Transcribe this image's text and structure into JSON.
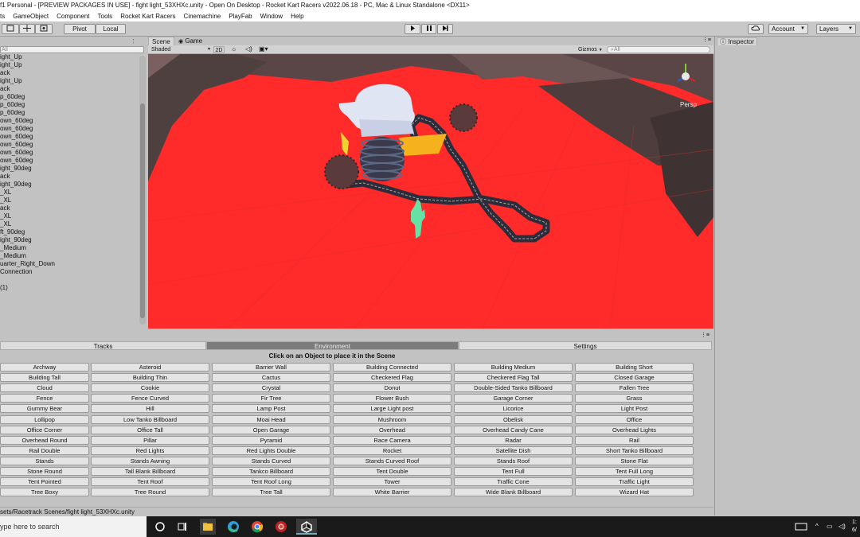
{
  "window": {
    "title": "f1 Personal - [PREVIEW PACKAGES IN USE] - fight light_53XHXc.unity - Open On Desktop - Rocket Kart Racers v2022.06.18 - PC, Mac & Linux Standalone <DX11>"
  },
  "menu": [
    "ts",
    "GameObject",
    "Component",
    "Tools",
    "Rocket Kart Racers",
    "Cinemachine",
    "PlayFab",
    "Window",
    "Help"
  ],
  "toolbar": {
    "pivot": "Pivot",
    "local": "Local",
    "account": "Account",
    "layers": "Layers"
  },
  "hierarchy": {
    "search_placeholder": "All",
    "items": [
      "ight_Up",
      "ight_Up",
      "ack",
      "ight_Up",
      "ack",
      "p_60deg",
      "p_60deg",
      "p_60deg",
      "own_60deg",
      "own_60deg",
      "own_60deg",
      "own_60deg",
      "own_60deg",
      "own_60deg",
      "ight_90deg",
      "ack",
      "ight_90deg",
      "_XL",
      "_XL",
      "ack",
      "_XL",
      "_XL",
      "ft_90deg",
      "ight_90deg",
      "_Medium",
      "_Medium",
      "uarter_Right_Down",
      "Connection",
      "",
      "(1)"
    ]
  },
  "scene": {
    "tab_scene": "Scene",
    "tab_game": "Game",
    "shading": "Shaded",
    "mode_2d": "2D",
    "gizmos": "Gizmos",
    "search_placeholder": "All",
    "persp": "Persp"
  },
  "inspector": {
    "tab": "Inspector"
  },
  "panel": {
    "tabs": [
      "Tracks",
      "Environment",
      "Settings"
    ],
    "active_tab": "Environment",
    "hint": "Click on an Object to place it in the Scene",
    "objects": [
      [
        "Archway",
        "Asteroid",
        "Barrier Wall",
        "Building Connected",
        "Building Medium",
        "Building Short"
      ],
      [
        "Building Tall",
        "Building Thin",
        "Cactus",
        "Checkered Flag",
        "Checkered Flag Tall",
        "Closed Garage"
      ],
      [
        "Cloud",
        "Cookie",
        "Crystal",
        "Donut",
        "Double-Sided Tanko Billboard",
        "Fallen Tree"
      ],
      [
        "Fence",
        "Fence Curved",
        "Fir Tree",
        "Flower Bush",
        "Garage Corner",
        "Grass"
      ],
      [
        "Gummy Bear",
        "Hill",
        "Lamp Post",
        "Large Light post",
        "Licorice",
        "Light Post"
      ],
      [
        "Lollipop",
        "Low Tanko Billboard",
        "Moai Head",
        "Mushroom",
        "Obelisk",
        "Office"
      ],
      [
        "Office Corner",
        "Office Tall",
        "Open Garage",
        "Overhead",
        "Overhead Candy Cane",
        "Overhead Lights"
      ],
      [
        "Overhead Round",
        "Pillar",
        "Pyramid",
        "Race Camera",
        "Radar",
        "Rail"
      ],
      [
        "Rail Double",
        "Red Lights",
        "Red Lights Double",
        "Rocket",
        "Satellite Dish",
        "Short Tanko Billboard"
      ],
      [
        "Stands",
        "Stands Awning",
        "Stands Curved",
        "Stands Curved Roof",
        "Stands Roof",
        "Stone Flat"
      ],
      [
        "Stone Round",
        "Tall Blank Billboard",
        "Tankco Billboard",
        "Tent Double",
        "Tent Full",
        "Tent Full Long"
      ],
      [
        "Tent Pointed",
        "Tent Roof",
        "Tent Roof Long",
        "Tower",
        "Traffic Cone",
        "Traffic Light"
      ],
      [
        "Tree Boxy",
        "Tree Round",
        "Tree Tall",
        "White Barrier",
        "Wide Blank Billboard",
        "Wizard Hat"
      ]
    ]
  },
  "status": {
    "path": "sets/Racetrack Scenes/fight light_53XHXc.unity"
  },
  "taskbar": {
    "search_text": "ype here to search",
    "clock_time": "1:",
    "clock_date": "6/"
  },
  "colors": {
    "ground": "#ff2a2a",
    "terrain": "#4a3f3f",
    "track": "#2c2c3a"
  }
}
